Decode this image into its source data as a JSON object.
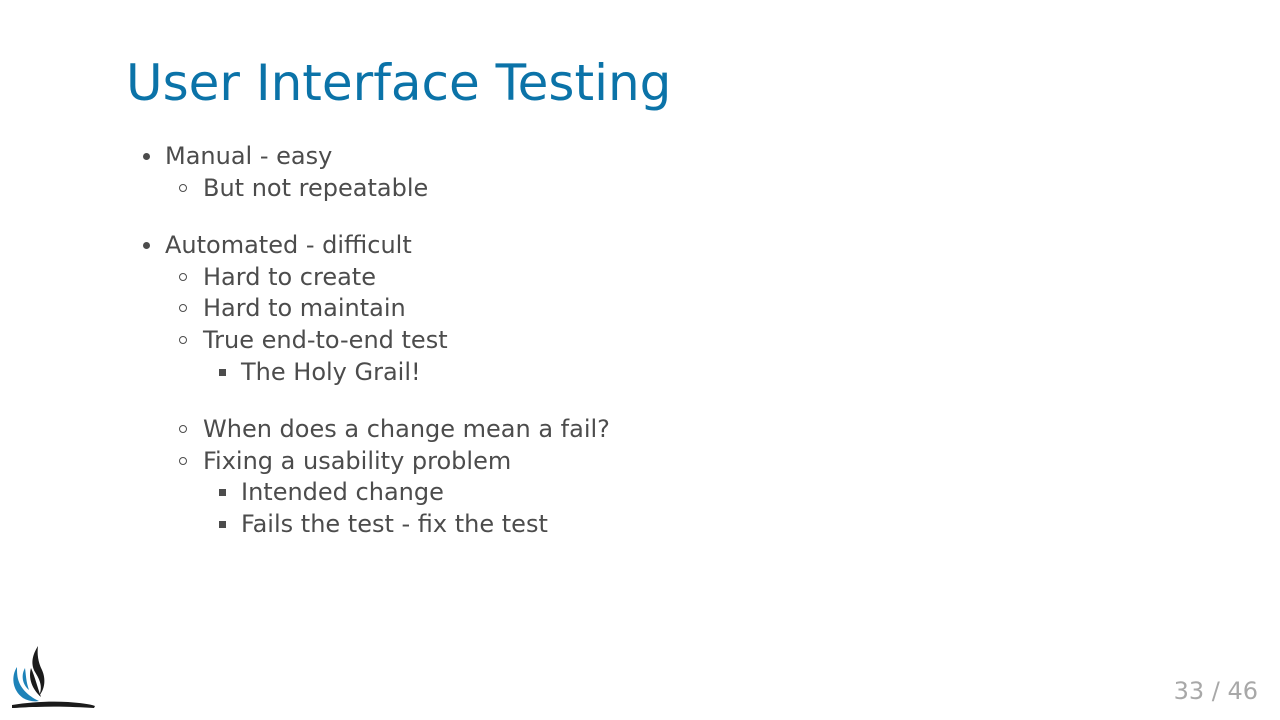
{
  "slide": {
    "title": "User Interface Testing",
    "bullets": {
      "manual": "Manual - easy",
      "manual_sub_1": "But not repeatable",
      "automated": "Automated - difficult",
      "automated_sub_1": "Hard to create",
      "automated_sub_2": "Hard to maintain",
      "automated_sub_3": "True end-to-end test",
      "automated_sub_3_detail_1": "The Holy Grail!",
      "automated_sub_4": "When does a change mean a fail?",
      "automated_sub_5": "Fixing a usability problem",
      "automated_sub_5_detail_1": "Intended change",
      "automated_sub_5_detail_2": "Fails the test - fix the test"
    }
  },
  "footer": {
    "page_number": "33 / 46"
  },
  "colors": {
    "title": "#0b73a8",
    "body_text": "#4c4c4c",
    "page_number": "#a8a8a8",
    "logo_blue": "#1d82b8",
    "logo_dark": "#1b1b1b"
  },
  "icons": {
    "logo": "heron-logo-icon"
  }
}
